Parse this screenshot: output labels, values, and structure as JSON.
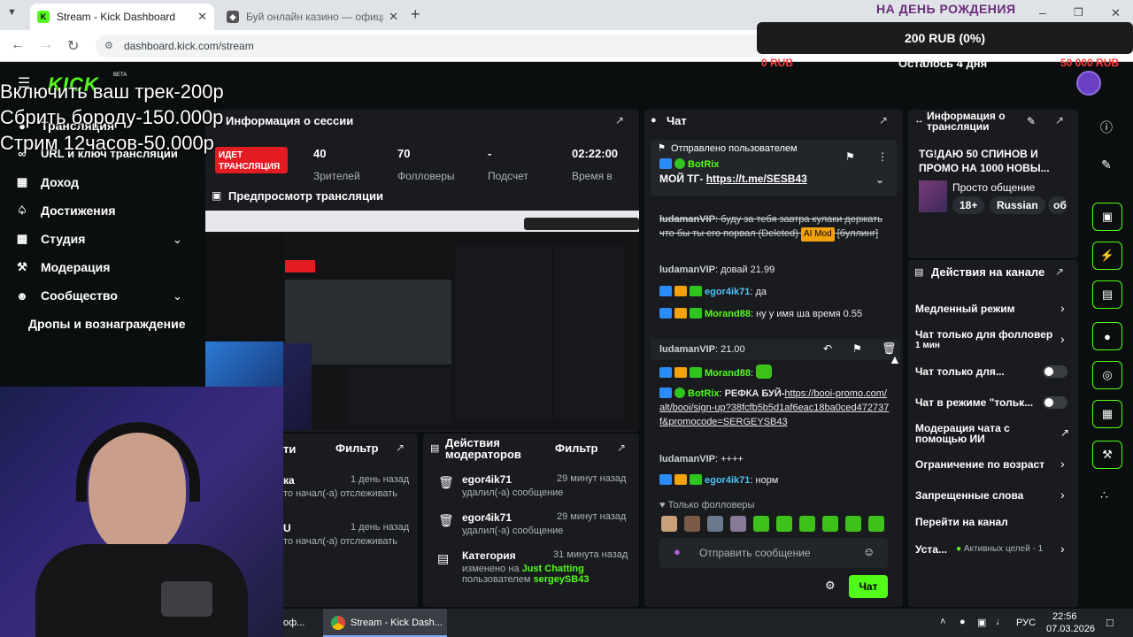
{
  "browser": {
    "tabs": [
      {
        "title": "Stream - Kick Dashboard",
        "active": true
      },
      {
        "title": "Буй онлайн казино — официа",
        "active": false
      }
    ],
    "url": "dashboard.kick.com/stream"
  },
  "donation_goal": {
    "title": "НА ДЕНЬ РОЖДЕНИЯ",
    "amount": "200 RUB (0%)",
    "min": "0 RUB",
    "remaining": "Осталось 4 дня",
    "max": "50 000 RUB",
    "progress_percent": 0
  },
  "overlay_lines": [
    "Включить ваш трек-200р",
    "Сбрить бороду-150.000р",
    "Стрим 12часов-50.000р"
  ],
  "kick": {
    "logo": "KICK",
    "beta": "BETA",
    "nav": [
      {
        "label": "Трансляция",
        "icon": "broadcast-icon"
      },
      {
        "label": "URL и ключ трансляции",
        "icon": "key-icon"
      },
      {
        "label": "Доход",
        "icon": "income-icon"
      },
      {
        "label": "Достижения",
        "icon": "trophy-icon"
      },
      {
        "label": "Студия",
        "icon": "studio-icon"
      },
      {
        "label": "Модерация",
        "icon": "wrench-icon"
      },
      {
        "label": "Сообщество",
        "icon": "community-icon"
      },
      {
        "label": "Дропы и вознаграждение",
        "icon": ""
      }
    ],
    "session": {
      "title": "Информация о сессии",
      "live_label": "ИДЕТ ТРАНСЛЯЦИЯ",
      "stats": [
        {
          "value": "40",
          "label": "Зрителей"
        },
        {
          "value": "70",
          "label": "Фолловеры"
        },
        {
          "value": "-",
          "label": "Подсчет"
        },
        {
          "value": "02:22:00",
          "label": "Время в"
        }
      ]
    },
    "preview": {
      "title": "Предпросмотр трансляции"
    },
    "activity": {
      "title": "ти",
      "filter": "Фильтр",
      "rows": [
        {
          "user": "ка",
          "text": "то начал(-а) отслеживать",
          "time": "1 день назад"
        },
        {
          "user": "U",
          "text": "то начал(-а) отслеживать",
          "time": "1 день назад"
        }
      ]
    },
    "mod_actions": {
      "title": "Действия модераторов",
      "filter": "Фильтр",
      "rows": [
        {
          "user": "egor4ik71",
          "text": "удалил(-а) сообщение",
          "time": "29 минут назад"
        },
        {
          "user": "egor4ik71",
          "text": "удалил(-а) сообщение",
          "time": "29 минут назад"
        },
        {
          "user": "Категория",
          "text1": "изменено на",
          "cat": "Just Chatting",
          "text2": "пользователем",
          "by": "sergeySB43",
          "time": "31 минута назад"
        }
      ]
    },
    "chat": {
      "title": "Чат",
      "pinned_by": "Отправлено пользователем",
      "pinned_user": "BotRix",
      "pinned_text": "МОЙ ТГ-",
      "pinned_link": "https://t.me/SESB43",
      "messages": [
        {
          "user": "ludamanVIP",
          "text": "буду за тебя завтра кулаки держать что бы ты его порвал (Deleted)",
          "mod": "AI Mod",
          "tag": "[буллинг]"
        },
        {
          "user": "ludamanVIP",
          "text": "довай 21.99"
        },
        {
          "user": "egor4ik71",
          "text": "да"
        },
        {
          "user": "Morand88",
          "text": "ну у имя ша время 0.55"
        },
        {
          "user": "ludamanVIP",
          "text": "21.00"
        },
        {
          "user": "Morand88",
          "text": ""
        },
        {
          "user": "BotRix",
          "text": "РЕФКА БУЙ-",
          "link": "https://booi-promo.com/alt/booi/sign-up?38fcfb5b5d1af6eac18ba0ced472737f&promocode=SERGEYSB43"
        },
        {
          "user": "ludamanVIP",
          "text": "++++"
        },
        {
          "user": "egor4ik71",
          "text": "норм"
        }
      ],
      "followers_only": "Только фолловеры",
      "placeholder": "Отправить сообщение",
      "send": "Чат"
    },
    "stream_info": {
      "title": "Информация о трансляции",
      "stream_title": "TG!ДАЮ 50 СПИНОВ И ПРОМО НА 1000 НОВЫ...",
      "category": "Просто общение",
      "tags": [
        "18+",
        "Russian",
        "об"
      ]
    },
    "channel_actions": {
      "title": "Действия на канале",
      "rows": [
        {
          "label": "Медленный режим",
          "control": "chevron"
        },
        {
          "label": "Чат только для фолловер",
          "sub": "1 мин",
          "control": "chevron"
        },
        {
          "label": "Чат только для...",
          "control": "toggle"
        },
        {
          "label": "Чат в режиме \"тольк...",
          "control": "toggle"
        },
        {
          "label": "Модерация чата с помощью ИИ",
          "control": "external"
        },
        {
          "label": "Ограничение по возраст",
          "control": "chevron"
        },
        {
          "label": "Запрещенные слова",
          "control": "chevron"
        },
        {
          "label": "Перейти на канал",
          "control": "none"
        },
        {
          "label": "Уста...",
          "sub": "Активных целей - 1",
          "control": "chevron"
        }
      ]
    }
  },
  "taskbar": {
    "items": [
      "оф...",
      "Stream - Kick Dash..."
    ],
    "lang": "РУС",
    "time": "22:56",
    "date": "07.03.2026"
  },
  "colors": {
    "kick_green": "#53fc18",
    "live_red": "#e31b23",
    "panel_bg": "#191b1f",
    "page_bg": "#0b0e0f"
  }
}
